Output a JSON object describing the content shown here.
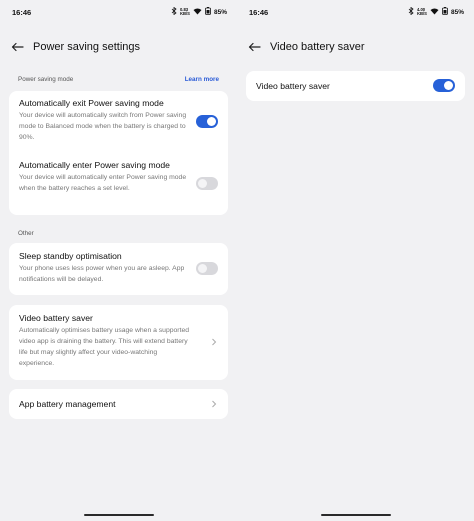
{
  "left": {
    "status": {
      "time": "16:46",
      "speed_top": "0.83",
      "speed_bottom": "KB/S",
      "battery": "85%"
    },
    "title": "Power saving settings",
    "section1": {
      "label": "Power saving mode",
      "link": "Learn more"
    },
    "auto_exit": {
      "title": "Automatically exit Power saving mode",
      "desc": "Your device will automatically switch from Power saving mode to Balanced mode when the battery is charged to 90%.",
      "enabled": true
    },
    "auto_enter": {
      "title": "Automatically enter Power saving mode",
      "desc": "Your device will automatically enter Power saving mode when the battery reaches a set level.",
      "enabled": false
    },
    "section2": {
      "label": "Other"
    },
    "sleep_standby": {
      "title": "Sleep standby optimisation",
      "desc": "Your phone uses less power when you are asleep. App notifications will be delayed.",
      "enabled": false
    },
    "video_saver": {
      "title": "Video battery saver",
      "desc": "Automatically optimises battery usage when a supported video app is draining the battery. This will extend battery life but may slightly affect your video-watching experience."
    },
    "app_battery": {
      "title": "App battery management"
    }
  },
  "right": {
    "status": {
      "time": "16:46",
      "speed_top": "4.00",
      "speed_bottom": "KB/S",
      "battery": "85%"
    },
    "title": "Video battery saver",
    "video_saver": {
      "title": "Video battery saver",
      "enabled": true
    }
  },
  "colors": {
    "accent": "#2761d8",
    "link": "#2a5bd7",
    "background": "#f1f1f3",
    "card": "#ffffff"
  },
  "icons": [
    "back-arrow-icon",
    "bluetooth-icon",
    "wifi-icon",
    "battery-saver-icon",
    "chevron-right-icon"
  ]
}
